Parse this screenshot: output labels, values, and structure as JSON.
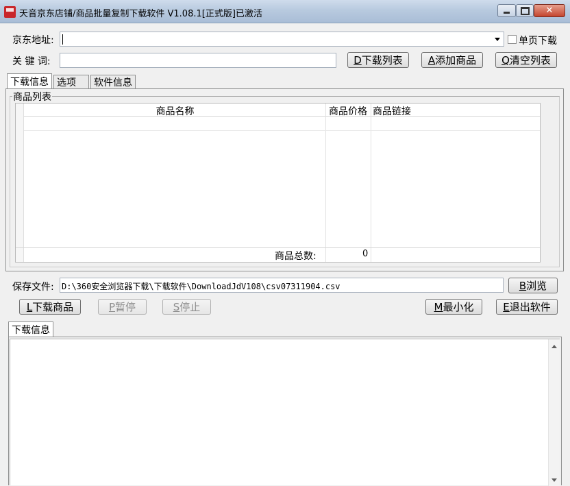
{
  "window": {
    "title": "天音京东店铺/商品批量复制下载软件 V1.08.1[正式版]已激活",
    "close_label": "✕"
  },
  "top": {
    "address_label": "京东地址:",
    "address_value": "",
    "single_page_label": "单页下载",
    "keyword_label": "关 键 词:",
    "keyword_value": "",
    "buttons": {
      "download_list": {
        "key": "D",
        "text": "下载列表"
      },
      "add_goods": {
        "key": "A",
        "text": "添加商品"
      },
      "clear_list": {
        "key": "Q",
        "text": "清空列表"
      }
    }
  },
  "tabs": [
    "下载信息",
    "选项",
    "软件信息"
  ],
  "goods_list": {
    "group_label": "商品列表",
    "columns": [
      "商品名称",
      "商品价格",
      "商品链接"
    ],
    "total_label": "商品总数:",
    "total_value": "0"
  },
  "save": {
    "label": "保存文件:",
    "path": "D:\\360安全浏览器下载\\下载软件\\DownloadJdV108\\csv07311904.csv",
    "browse": {
      "key": "B",
      "text": "浏览"
    }
  },
  "actions": {
    "download": {
      "key": "L",
      "text": "下载商品"
    },
    "pause": {
      "key": "P",
      "text": "暂停"
    },
    "stop": {
      "key": "S",
      "text": "停止"
    },
    "minimize": {
      "key": "M",
      "text": "最小化"
    },
    "exit": {
      "key": "E",
      "text": "退出软件"
    }
  },
  "log": {
    "tab_label": "下载信息",
    "content": ""
  },
  "colors": {
    "titlebar": "#b8cadf",
    "close_button": "#c4452e",
    "window_bg": "#f0f0f0",
    "icon_red": "#c8262b"
  }
}
